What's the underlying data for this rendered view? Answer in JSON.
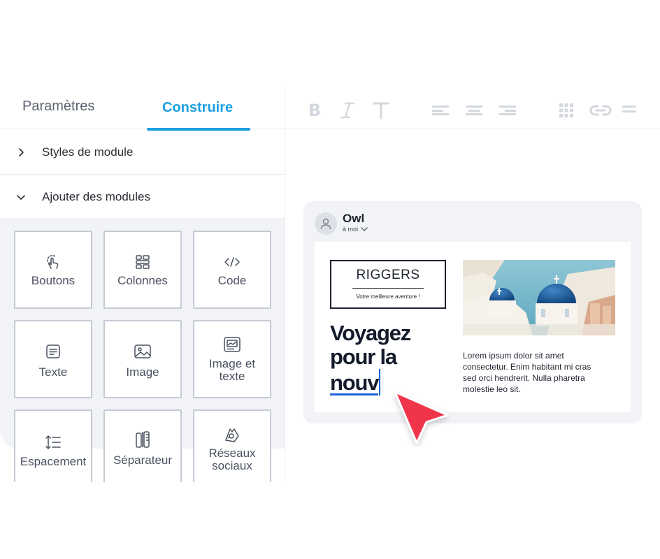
{
  "sidebar": {
    "tabs": [
      {
        "label": "Paramètres",
        "active": false
      },
      {
        "label": "Construire",
        "active": true
      }
    ],
    "sections": [
      {
        "label": "Styles de module",
        "expanded": false
      },
      {
        "label": "Ajouter des modules",
        "expanded": true
      }
    ],
    "modules": [
      {
        "label": "Boutons",
        "icon": "tap-icon"
      },
      {
        "label": "Colonnes",
        "icon": "columns-icon"
      },
      {
        "label": "Code",
        "icon": "code-icon"
      },
      {
        "label": "Texte",
        "icon": "text-icon"
      },
      {
        "label": "Image",
        "icon": "image-icon"
      },
      {
        "label": "Image et texte",
        "icon": "image-text-icon"
      },
      {
        "label": "Espacement",
        "icon": "spacing-icon"
      },
      {
        "label": "Séparateur",
        "icon": "divider-icon"
      },
      {
        "label": "Réseaux sociaux",
        "icon": "social-icon"
      }
    ]
  },
  "toolbar": {
    "buttons": [
      "bold-icon",
      "italic-icon",
      "text-size-icon",
      "align-left-icon",
      "align-center-icon",
      "align-right-icon",
      "grid-icon",
      "link-icon",
      "divider-icon"
    ],
    "bold_glyph": "B",
    "italic_glyph": "I",
    "text_glyph": "T"
  },
  "email": {
    "sender": "Owl",
    "recipient": "à moi",
    "logo_title": "RIGGERS",
    "logo_subtitle": "Votre meilleure aventure !",
    "headline_lines": [
      "Voyagez",
      "pour la",
      "nouv"
    ],
    "paragraph": "Lorem ipsum dolor sit amet consectetur. Enim habitant mi cras sed orci hendrerit. Nulla pharetra molestie leo sit."
  },
  "colors": {
    "accent": "#1ea0e0",
    "cursor": "#f0344c",
    "caret": "#1a63d6",
    "tile_border": "#c5cad4",
    "panel_bg": "#f1f3f6"
  }
}
